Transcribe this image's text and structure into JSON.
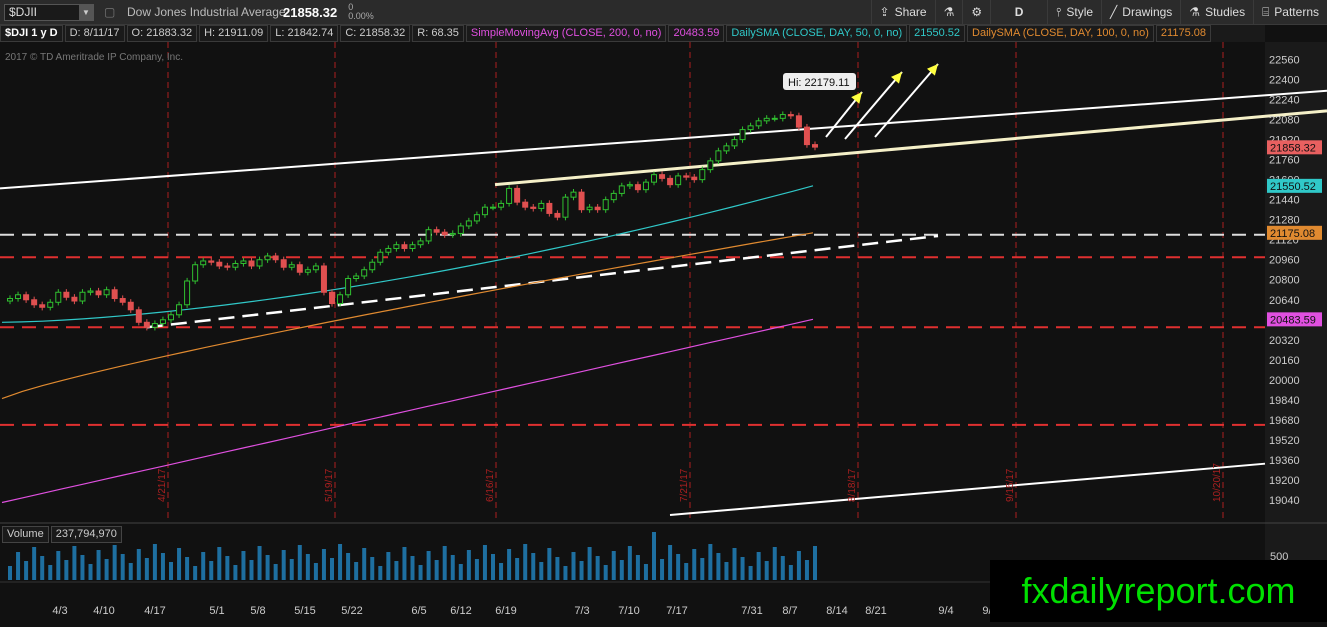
{
  "toolbar": {
    "symbol": "$DJII",
    "name": "Dow Jones Industrial Average",
    "last": "21858.32",
    "change": "0",
    "change_pct": "0.00%",
    "share_label": "Share",
    "period_label": "D",
    "style_label": "Style",
    "drawings_label": "Drawings",
    "studies_label": "Studies",
    "patterns_label": "Patterns"
  },
  "info": {
    "symbol_period": "$DJI 1 y D",
    "date": "D: 8/11/17",
    "open": "O: 21883.32",
    "high": "H: 21911.09",
    "low": "L: 21842.74",
    "close": "C: 21858.32",
    "range": "R: 68.35",
    "sma200_label": "SimpleMovingAvg (CLOSE, 200, 0, no)",
    "sma200_value": "20483.59",
    "sma50_label": "DailySMA (CLOSE, DAY, 50, 0, no)",
    "sma50_value": "21550.52",
    "sma100_label": "DailySMA (CLOSE, DAY, 100, 0, no)",
    "sma100_value": "21175.08"
  },
  "copyright": "2017 © TD Ameritrade IP Company, Inc.",
  "volume": {
    "label": "Volume",
    "value": "237,794,970",
    "axis_label": "500"
  },
  "watermark": "fxdailyreport.com",
  "chart_data": {
    "type": "candlestick",
    "ylim": [
      18880,
      22700
    ],
    "y_ticks": [
      19040,
      19200,
      19360,
      19520,
      19680,
      19840,
      20000,
      20160,
      20320,
      20480,
      20640,
      20800,
      20960,
      21120,
      21280,
      21440,
      21600,
      21760,
      21920,
      22080,
      22240,
      22400,
      22560
    ],
    "x_ticks": [
      "4/3",
      "4/10",
      "4/17",
      "5/1",
      "5/8",
      "5/15",
      "5/22",
      "6/5",
      "6/12",
      "6/19",
      "7/3",
      "7/10",
      "7/17",
      "7/31",
      "8/7",
      "8/14",
      "8/21",
      "9/4",
      "9/"
    ],
    "expiry_labels": [
      "4/21/17",
      "5/19/17",
      "6/16/17",
      "7/21/17",
      "8/18/17",
      "9/15/17",
      "10/20/17"
    ],
    "hi_annotation": "Hi: 22179.11",
    "price_labels": [
      {
        "text": "21858.32",
        "value": 21858.32,
        "color": "#e86060"
      },
      {
        "text": "21550.52",
        "value": 21550.52,
        "color": "#30c8c8"
      },
      {
        "text": "21175.08",
        "value": 21175.08,
        "color": "#e08a30"
      },
      {
        "text": "20483.59",
        "value": 20483.59,
        "color": "#e050e0"
      }
    ],
    "series": [
      {
        "name": "SimpleMovingAvg (CLOSE, 200, 0, no)",
        "color": "#e050e0",
        "start": 19020,
        "end": 20483.59
      },
      {
        "name": "DailySMA (CLOSE, DAY, 50, 0, no)",
        "color": "#30c8c8",
        "start": 20460,
        "end": 21550.52
      },
      {
        "name": "DailySMA (CLOSE, DAY, 100, 0, no)",
        "color": "#e08a30",
        "start": 19850,
        "end": 21175.08
      }
    ],
    "candles": [
      20650,
      20680,
      20640,
      20600,
      20580,
      20620,
      20700,
      20660,
      20630,
      20700,
      20710,
      20680,
      20720,
      20650,
      20620,
      20560,
      20460,
      20420,
      20450,
      20480,
      20520,
      20600,
      20790,
      20920,
      20950,
      20940,
      20910,
      20900,
      20930,
      20950,
      20910,
      20960,
      20990,
      20960,
      20900,
      20920,
      20860,
      20880,
      20910,
      20700,
      20610,
      20680,
      20810,
      20830,
      20880,
      20940,
      21020,
      21050,
      21080,
      21050,
      21080,
      21110,
      21200,
      21180,
      21160,
      21170,
      21230,
      21270,
      21320,
      21380,
      21380,
      21410,
      21530,
      21420,
      21380,
      21370,
      21410,
      21330,
      21300,
      21460,
      21500,
      21360,
      21380,
      21360,
      21440,
      21490,
      21550,
      21560,
      21520,
      21580,
      21640,
      21610,
      21560,
      21630,
      21620,
      21600,
      21680,
      21750,
      21830,
      21870,
      21920,
      22000,
      22030,
      22070,
      22090,
      22090,
      22120,
      22110,
      22020,
      21880,
      21860
    ],
    "horizontal_levels": [
      20420,
      20980,
      21160,
      19640
    ],
    "volume_labels": [
      "237,794,970"
    ]
  }
}
